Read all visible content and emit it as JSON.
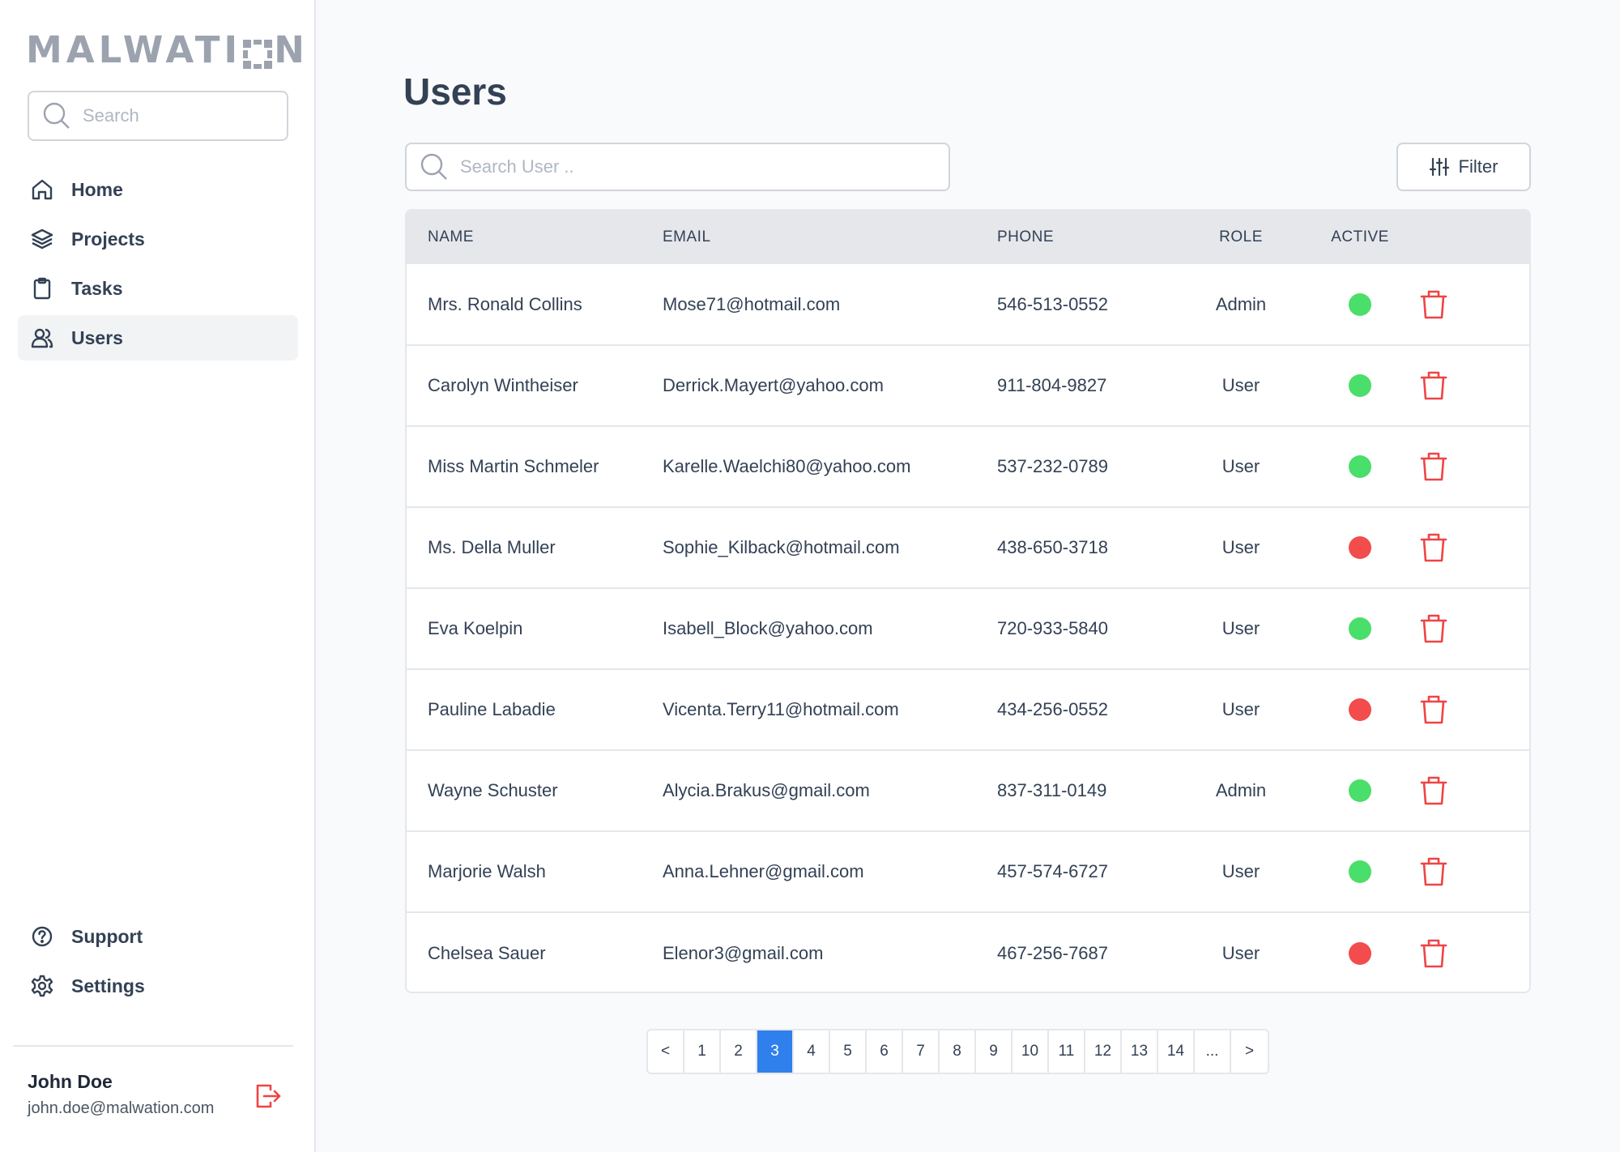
{
  "brand": {
    "logo_left": "MALWATI",
    "logo_right": "N"
  },
  "sidebar": {
    "search_placeholder": "Search",
    "items": [
      {
        "label": "Home",
        "icon": "home-icon"
      },
      {
        "label": "Projects",
        "icon": "layers-icon"
      },
      {
        "label": "Tasks",
        "icon": "clipboard-icon"
      },
      {
        "label": "Users",
        "icon": "users-icon",
        "active": true
      }
    ],
    "bottom_items": [
      {
        "label": "Support",
        "icon": "help-circle-icon"
      },
      {
        "label": "Settings",
        "icon": "gear-icon"
      }
    ],
    "profile": {
      "name": "John Doe",
      "email": "john.doe@malwation.com"
    }
  },
  "main": {
    "title": "Users",
    "search_placeholder": "Search User ..",
    "filter_label": "Filter",
    "columns": {
      "name": "NAME",
      "email": "EMAIL",
      "phone": "PHONE",
      "role": "ROLE",
      "active": "ACTIVE"
    },
    "rows": [
      {
        "name": "Mrs. Ronald Collins",
        "email": "Mose71@hotmail.com",
        "phone": "546-513-0552",
        "role": "Admin",
        "active": true
      },
      {
        "name": "Carolyn Wintheiser",
        "email": "Derrick.Mayert@yahoo.com",
        "phone": "911-804-9827",
        "role": "User",
        "active": true
      },
      {
        "name": "Miss Martin Schmeler",
        "email": "Karelle.Waelchi80@yahoo.com",
        "phone": "537-232-0789",
        "role": "User",
        "active": true
      },
      {
        "name": "Ms. Della Muller",
        "email": "Sophie_Kilback@hotmail.com",
        "phone": "438-650-3718",
        "role": "User",
        "active": false
      },
      {
        "name": "Eva Koelpin",
        "email": "Isabell_Block@yahoo.com",
        "phone": "720-933-5840",
        "role": "User",
        "active": true
      },
      {
        "name": "Pauline Labadie",
        "email": "Vicenta.Terry11@hotmail.com",
        "phone": "434-256-0552",
        "role": "User",
        "active": false
      },
      {
        "name": "Wayne Schuster",
        "email": "Alycia.Brakus@gmail.com",
        "phone": "837-311-0149",
        "role": "Admin",
        "active": true
      },
      {
        "name": "Marjorie Walsh",
        "email": "Anna.Lehner@gmail.com",
        "phone": "457-574-6727",
        "role": "User",
        "active": true
      },
      {
        "name": "Chelsea Sauer",
        "email": "Elenor3@gmail.com",
        "phone": "467-256-7687",
        "role": "User",
        "active": false
      }
    ],
    "pagination": {
      "pages": [
        "<",
        "1",
        "2",
        "3",
        "4",
        "5",
        "6",
        "7",
        "8",
        "9",
        "10",
        "11",
        "12",
        "13",
        "14",
        "...",
        ">"
      ],
      "current": "3"
    }
  },
  "colors": {
    "active_green": "#4ade6a",
    "inactive_red": "#f24c4c",
    "delete_red": "#ef4444",
    "accent_blue": "#2f80ed"
  }
}
